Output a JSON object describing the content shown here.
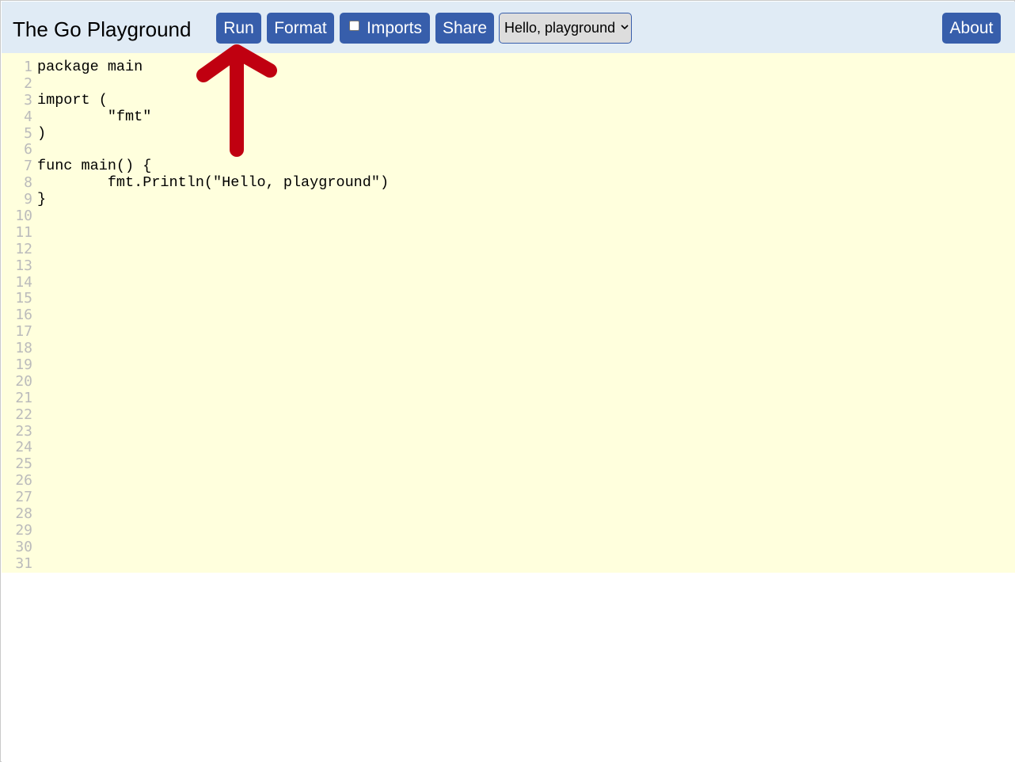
{
  "header": {
    "title": "The Go Playground",
    "run_label": "Run",
    "format_label": "Format",
    "imports_label": "Imports",
    "imports_checked": false,
    "share_label": "Share",
    "example_select": {
      "selected": "Hello, playground"
    },
    "about_label": "About"
  },
  "editor": {
    "line_numbers": [
      "1",
      "2",
      "3",
      "4",
      "5",
      "6",
      "7",
      "8",
      "9",
      "10",
      "11",
      "12",
      "13",
      "14",
      "15",
      "16",
      "17",
      "18",
      "19",
      "20",
      "21",
      "22",
      "23",
      "24",
      "25",
      "26",
      "27",
      "28",
      "29",
      "30",
      "31"
    ],
    "code_lines": [
      "package main",
      "",
      "import (",
      "        \"fmt\"",
      ")",
      "",
      "func main() {",
      "        fmt.Println(\"Hello, playground\")",
      "}"
    ]
  },
  "annotation": {
    "arrow_color": "#c00010"
  },
  "colors": {
    "header_bg": "#e0ebf5",
    "button_bg": "#375eab",
    "editor_bg": "#ffffdd",
    "line_number": "#bbbbbb"
  }
}
